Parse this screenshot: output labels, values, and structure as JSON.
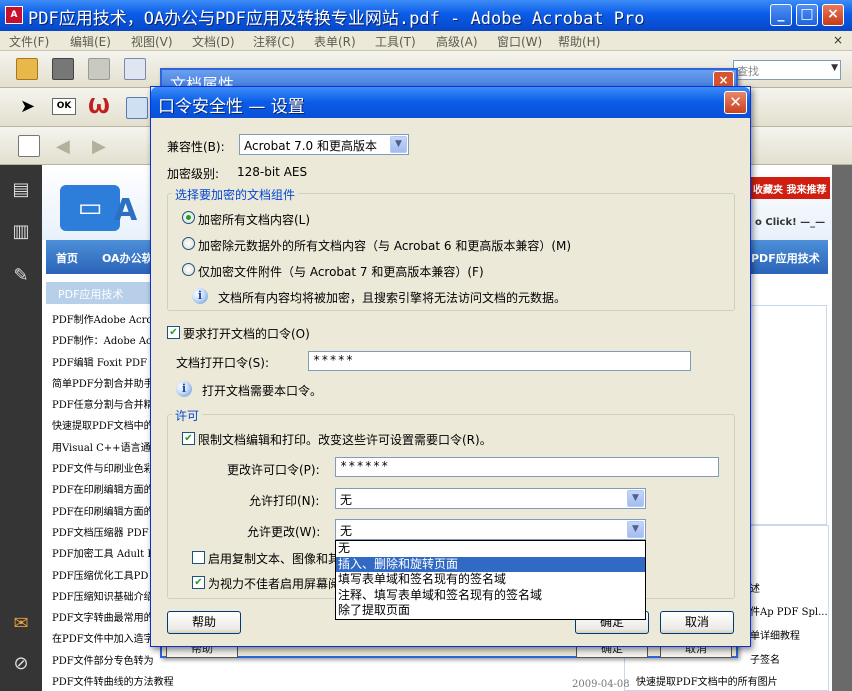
{
  "window": {
    "title": "PDF应用技术，OA办公与PDF应用及转换专业网站.pdf - Adobe Acrobat Pro",
    "app_icon": "pdf-icon",
    "controls": [
      "_",
      "□",
      "×"
    ]
  },
  "menubar": {
    "items": [
      "文件(F)",
      "编辑(E)",
      "视图(V)",
      "文档(D)",
      "注释(C)",
      "表单(R)",
      "工具(T)",
      "高级(A)",
      "窗口(W)",
      "帮助(H)"
    ],
    "close_glyph": "×"
  },
  "toolbar": {
    "find_placeholder": "查找",
    "ok_label": "OK"
  },
  "webpage": {
    "logo_letter": "A",
    "favorites": "收藏夹 我来推荐",
    "click": "o Click! —_—",
    "nav": [
      "首页",
      "OA办公软",
      "PDF应用技术"
    ],
    "side_header": "PDF应用技术",
    "list": [
      "PDF制作Adobe Acrobat",
      "PDF制作：Adobe Acro",
      "PDF编辑 Foxit PDF Pa",
      "简单PDF分割合并助手",
      "PDF任意分割与合并精",
      "快速提取PDF文档中的",
      "用Visual C++语言通过",
      "PDF文件与印刷业色彩",
      "PDF在印刷编辑方面的",
      "PDF在印刷编辑方面的",
      "PDF文档压缩器 PDF C",
      "PDF加密工具 Adult PD",
      "PDF压缩优化工具PD",
      "PDF压缩知识基础介绍",
      "PDF文字转曲最常用的",
      "在PDF文件中加入造字",
      "PDF文件部分专色转为",
      "PDF文件转曲线的方法教程"
    ],
    "right_items": [
      "述",
      "件Ap PDF Spl...",
      "单详细教程",
      "子签名"
    ],
    "bottom_item": "快速提取PDF文档中的所有图片",
    "date": "2009-04-08"
  },
  "back_dialog": {
    "title": "文档属性",
    "help_label": "帮助",
    "ok_label": "确定",
    "cancel_label": "取消"
  },
  "dialog": {
    "title": "口令安全性 — 设置",
    "compat_label": "兼容性(B):",
    "compat_value": "Acrobat 7.0 和更高版本",
    "enc_label": "加密级别:",
    "enc_value": "128-bit AES",
    "components_group": "选择要加密的文档组件",
    "radio_all": "加密所有文档内容(L)",
    "radio_except_meta": "加密除元数据外的所有文档内容（与 Acrobat 6 和更高版本兼容）(M)",
    "radio_attachments": "仅加密文件附件（与 Acrobat 7 和更高版本兼容）(F)",
    "components_info": "文档所有内容均将被加密，且搜索引擎将无法访问文档的元数据。",
    "require_open_pw": "要求打开文档的口令(O)",
    "open_pw_label": "文档打开口令(S):",
    "open_pw_value": "*****",
    "open_pw_info": "打开文档需要本口令。",
    "perm_group": "许可",
    "restrict_label": "限制文档编辑和打印。改变这些许可设置需要口令(R)。",
    "change_pw_label": "更改许可口令(P):",
    "change_pw_value": "******",
    "print_label": "允许打印(N):",
    "print_value": "无",
    "changes_label": "允许更改(W):",
    "changes_value": "无",
    "copy_label": "启用复制文本、图像和其",
    "screenreader_label": "为视力不佳者启用屏幕阅",
    "changes_options": [
      "无",
      "插入、删除和旋转页面",
      "填写表单域和签名现有的签名域",
      "注释、填写表单域和签名现有的签名域",
      "除了提取页面"
    ],
    "changes_selected_index": 1,
    "help_button": "帮助",
    "ok_button": "确定",
    "cancel_button": "取消"
  }
}
